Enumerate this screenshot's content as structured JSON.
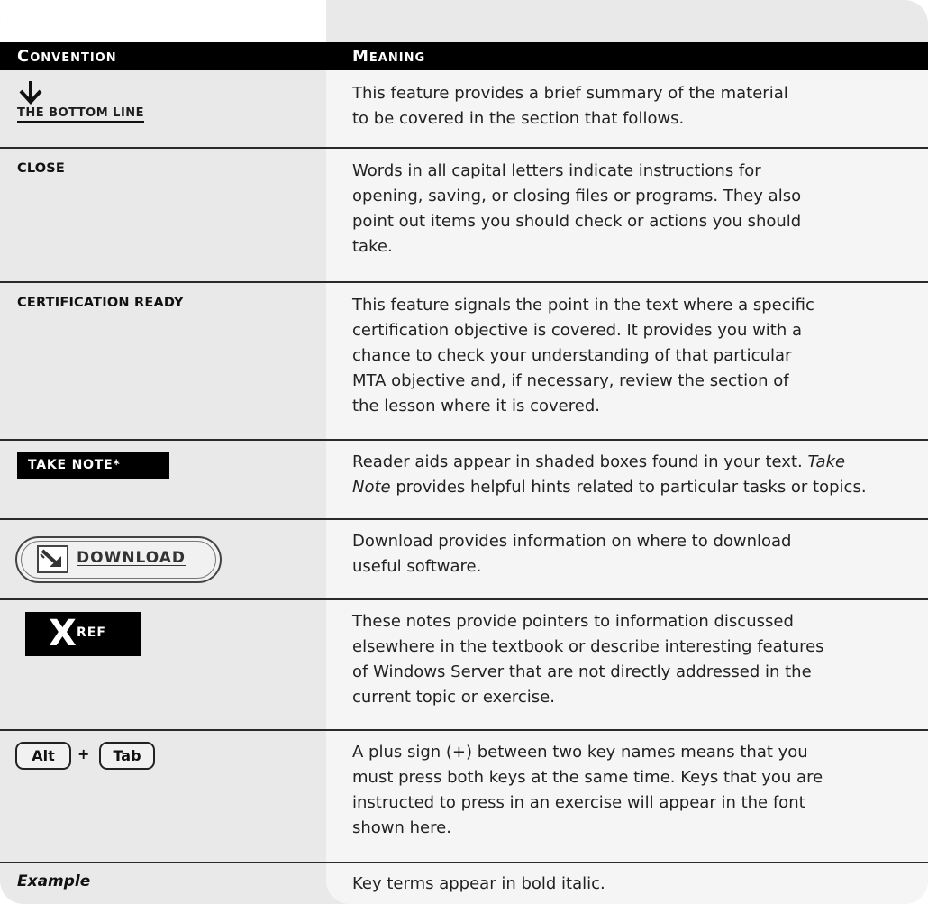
{
  "header": {
    "convention": "Convention",
    "meaning": "Meaning"
  },
  "rows": [
    {
      "convention_label": "THE BOTTOM LINE",
      "meaning_lines": [
        "This feature provides a brief summary of the material",
        "to be covered in the section that follows."
      ]
    },
    {
      "convention_label": "CLOSE",
      "meaning_lines": [
        "Words in all capital letters indicate instructions for",
        "opening, saving, or closing files or programs. They also",
        "point out items you should check or actions you should",
        "take."
      ]
    },
    {
      "convention_label": "CERTIFICATION READY",
      "meaning_lines": [
        "This feature signals the point in the text where a specific",
        "certification objective is covered. It provides you with a",
        "chance to check your understanding of that particular",
        "MTA objective and, if necessary, review the section of",
        "the lesson where it is covered."
      ]
    },
    {
      "convention_label": "TAKE NOTE*",
      "meaning_line1_before": "Reader aids appear in shaded boxes found in your text. ",
      "meaning_line1_italic": "Take",
      "meaning_line2_italic": "Note",
      "meaning_line2_after": " provides helpful hints related to particular tasks or topics."
    },
    {
      "convention_label": "DOWNLOAD",
      "meaning_lines": [
        "Download provides information on where to download",
        "useful software."
      ]
    },
    {
      "convention_big": "X",
      "convention_small": "REF",
      "meaning_lines": [
        "These notes provide pointers to information discussed",
        "elsewhere in the textbook or describe interesting features",
        "of Windows Server that are not directly addressed in the",
        "current topic or exercise."
      ]
    },
    {
      "key1": "Alt",
      "plus": "+",
      "key2": "Tab",
      "meaning_lines": [
        "A plus sign (+) between two key names means that you",
        "must press both keys at the same time. Keys that you are",
        "instructed to press in an exercise will appear in the font",
        "shown here."
      ]
    },
    {
      "convention_label": "Example",
      "meaning_lines": [
        "Key terms appear in bold italic."
      ]
    }
  ]
}
